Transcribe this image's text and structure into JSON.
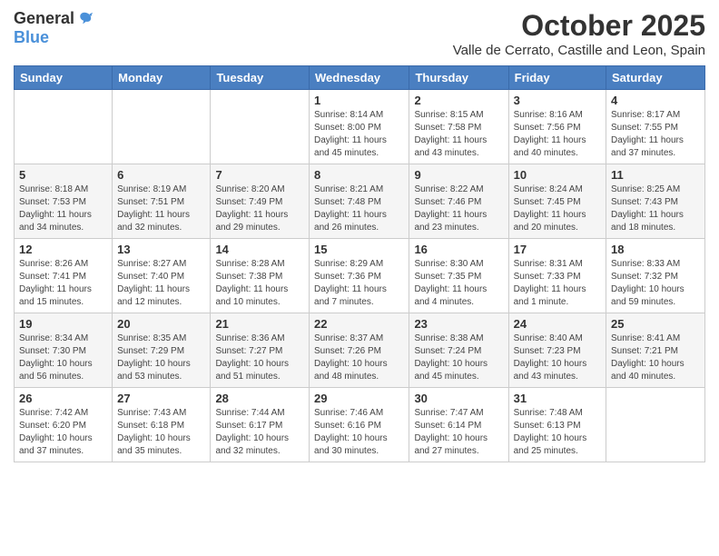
{
  "logo": {
    "general": "General",
    "blue": "Blue"
  },
  "header": {
    "month": "October 2025",
    "location": "Valle de Cerrato, Castille and Leon, Spain"
  },
  "weekdays": [
    "Sunday",
    "Monday",
    "Tuesday",
    "Wednesday",
    "Thursday",
    "Friday",
    "Saturday"
  ],
  "weeks": [
    [
      {
        "day": "",
        "info": ""
      },
      {
        "day": "",
        "info": ""
      },
      {
        "day": "",
        "info": ""
      },
      {
        "day": "1",
        "info": "Sunrise: 8:14 AM\nSunset: 8:00 PM\nDaylight: 11 hours\nand 45 minutes."
      },
      {
        "day": "2",
        "info": "Sunrise: 8:15 AM\nSunset: 7:58 PM\nDaylight: 11 hours\nand 43 minutes."
      },
      {
        "day": "3",
        "info": "Sunrise: 8:16 AM\nSunset: 7:56 PM\nDaylight: 11 hours\nand 40 minutes."
      },
      {
        "day": "4",
        "info": "Sunrise: 8:17 AM\nSunset: 7:55 PM\nDaylight: 11 hours\nand 37 minutes."
      }
    ],
    [
      {
        "day": "5",
        "info": "Sunrise: 8:18 AM\nSunset: 7:53 PM\nDaylight: 11 hours\nand 34 minutes."
      },
      {
        "day": "6",
        "info": "Sunrise: 8:19 AM\nSunset: 7:51 PM\nDaylight: 11 hours\nand 32 minutes."
      },
      {
        "day": "7",
        "info": "Sunrise: 8:20 AM\nSunset: 7:49 PM\nDaylight: 11 hours\nand 29 minutes."
      },
      {
        "day": "8",
        "info": "Sunrise: 8:21 AM\nSunset: 7:48 PM\nDaylight: 11 hours\nand 26 minutes."
      },
      {
        "day": "9",
        "info": "Sunrise: 8:22 AM\nSunset: 7:46 PM\nDaylight: 11 hours\nand 23 minutes."
      },
      {
        "day": "10",
        "info": "Sunrise: 8:24 AM\nSunset: 7:45 PM\nDaylight: 11 hours\nand 20 minutes."
      },
      {
        "day": "11",
        "info": "Sunrise: 8:25 AM\nSunset: 7:43 PM\nDaylight: 11 hours\nand 18 minutes."
      }
    ],
    [
      {
        "day": "12",
        "info": "Sunrise: 8:26 AM\nSunset: 7:41 PM\nDaylight: 11 hours\nand 15 minutes."
      },
      {
        "day": "13",
        "info": "Sunrise: 8:27 AM\nSunset: 7:40 PM\nDaylight: 11 hours\nand 12 minutes."
      },
      {
        "day": "14",
        "info": "Sunrise: 8:28 AM\nSunset: 7:38 PM\nDaylight: 11 hours\nand 10 minutes."
      },
      {
        "day": "15",
        "info": "Sunrise: 8:29 AM\nSunset: 7:36 PM\nDaylight: 11 hours\nand 7 minutes."
      },
      {
        "day": "16",
        "info": "Sunrise: 8:30 AM\nSunset: 7:35 PM\nDaylight: 11 hours\nand 4 minutes."
      },
      {
        "day": "17",
        "info": "Sunrise: 8:31 AM\nSunset: 7:33 PM\nDaylight: 11 hours\nand 1 minute."
      },
      {
        "day": "18",
        "info": "Sunrise: 8:33 AM\nSunset: 7:32 PM\nDaylight: 10 hours\nand 59 minutes."
      }
    ],
    [
      {
        "day": "19",
        "info": "Sunrise: 8:34 AM\nSunset: 7:30 PM\nDaylight: 10 hours\nand 56 minutes."
      },
      {
        "day": "20",
        "info": "Sunrise: 8:35 AM\nSunset: 7:29 PM\nDaylight: 10 hours\nand 53 minutes."
      },
      {
        "day": "21",
        "info": "Sunrise: 8:36 AM\nSunset: 7:27 PM\nDaylight: 10 hours\nand 51 minutes."
      },
      {
        "day": "22",
        "info": "Sunrise: 8:37 AM\nSunset: 7:26 PM\nDaylight: 10 hours\nand 48 minutes."
      },
      {
        "day": "23",
        "info": "Sunrise: 8:38 AM\nSunset: 7:24 PM\nDaylight: 10 hours\nand 45 minutes."
      },
      {
        "day": "24",
        "info": "Sunrise: 8:40 AM\nSunset: 7:23 PM\nDaylight: 10 hours\nand 43 minutes."
      },
      {
        "day": "25",
        "info": "Sunrise: 8:41 AM\nSunset: 7:21 PM\nDaylight: 10 hours\nand 40 minutes."
      }
    ],
    [
      {
        "day": "26",
        "info": "Sunrise: 7:42 AM\nSunset: 6:20 PM\nDaylight: 10 hours\nand 37 minutes."
      },
      {
        "day": "27",
        "info": "Sunrise: 7:43 AM\nSunset: 6:18 PM\nDaylight: 10 hours\nand 35 minutes."
      },
      {
        "day": "28",
        "info": "Sunrise: 7:44 AM\nSunset: 6:17 PM\nDaylight: 10 hours\nand 32 minutes."
      },
      {
        "day": "29",
        "info": "Sunrise: 7:46 AM\nSunset: 6:16 PM\nDaylight: 10 hours\nand 30 minutes."
      },
      {
        "day": "30",
        "info": "Sunrise: 7:47 AM\nSunset: 6:14 PM\nDaylight: 10 hours\nand 27 minutes."
      },
      {
        "day": "31",
        "info": "Sunrise: 7:48 AM\nSunset: 6:13 PM\nDaylight: 10 hours\nand 25 minutes."
      },
      {
        "day": "",
        "info": ""
      }
    ]
  ]
}
